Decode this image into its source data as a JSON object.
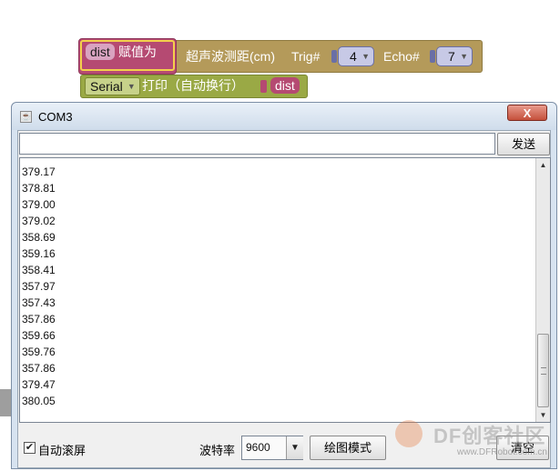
{
  "blocks": {
    "assign": {
      "var": "dist",
      "label": "赋值为"
    },
    "sonar": {
      "label": "超声波测距(cm)",
      "trig_label": "Trig#",
      "trig_value": "4",
      "echo_label": "Echo#",
      "echo_value": "7"
    },
    "print": {
      "serial": "Serial",
      "label": "打印（自动换行）",
      "var": "dist"
    },
    "colors": {
      "assign": "#b54a72",
      "sonar": "#b49a5a",
      "print": "#9aa945"
    }
  },
  "window": {
    "title": "COM3",
    "close": "X",
    "send_value": "",
    "send_label": "发送",
    "output_lines": [
      "379.17",
      "378.81",
      "379.00",
      "379.02",
      "358.69",
      "359.16",
      "358.41",
      "357.97",
      "357.43",
      "357.86",
      "359.66",
      "359.76",
      "357.86",
      "379.47",
      "380.05"
    ],
    "autoscroll_label": "自动滚屏",
    "autoscroll_checked": "✔",
    "baud_label": "波特率",
    "baud_value": "9600",
    "plot_label": "绘图模式",
    "clear_label": "清空"
  },
  "watermark": {
    "text": "DF创客社区",
    "url": "www.DFRobot.com.cn"
  }
}
